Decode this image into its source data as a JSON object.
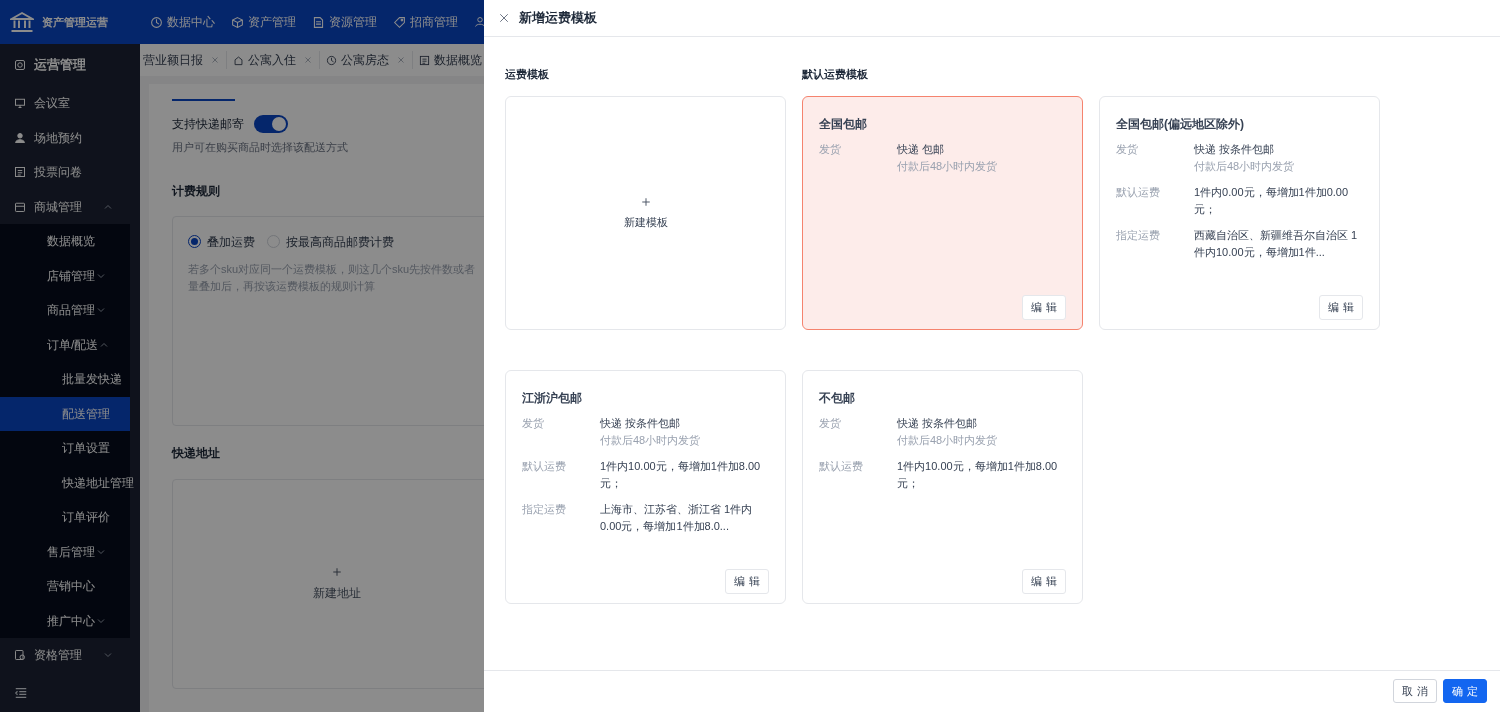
{
  "app": {
    "title": "资产管理运营",
    "top_nav": [
      {
        "label": "数据中心"
      },
      {
        "label": "资产管理"
      },
      {
        "label": "资源管理"
      },
      {
        "label": "招商管理"
      }
    ],
    "sidebar": {
      "header": "运营管理",
      "items": [
        {
          "label": "会议室",
          "kind": "link",
          "selected": false
        },
        {
          "label": "场地预约",
          "kind": "link",
          "selected": false
        },
        {
          "label": "投票问卷",
          "kind": "link",
          "selected": false
        },
        {
          "label": "商城管理",
          "kind": "group",
          "expanded": true,
          "children": [
            {
              "label": "数据概览",
              "kind": "link",
              "selected": false
            },
            {
              "label": "店铺管理",
              "kind": "group",
              "expanded": false
            },
            {
              "label": "商品管理",
              "kind": "group",
              "expanded": false
            },
            {
              "label": "订单/配送",
              "kind": "group",
              "expanded": true,
              "children": [
                {
                  "label": "批量发快递",
                  "kind": "link",
                  "selected": false
                },
                {
                  "label": "配送管理",
                  "kind": "link",
                  "selected": true
                },
                {
                  "label": "订单设置",
                  "kind": "link",
                  "selected": false
                },
                {
                  "label": "快递地址管理",
                  "kind": "link",
                  "selected": false
                },
                {
                  "label": "订单评价",
                  "kind": "link",
                  "selected": false
                }
              ]
            },
            {
              "label": "售后管理",
              "kind": "group",
              "expanded": false
            },
            {
              "label": "营销中心",
              "kind": "link",
              "selected": false
            },
            {
              "label": "推广中心",
              "kind": "group",
              "expanded": false
            }
          ]
        },
        {
          "label": "资格管理",
          "kind": "group",
          "expanded": false
        }
      ]
    },
    "tabs": [
      {
        "label": "营业额日报"
      },
      {
        "label": "公寓入住"
      },
      {
        "label": "公寓房态"
      },
      {
        "label": "数据概览"
      }
    ],
    "form": {
      "toggle_label": "支持快递邮寄",
      "toggle_on": true,
      "toggle_hint": "用户可在购买商品时选择该配送方式",
      "billing_title": "计费规则",
      "billing_options": [
        {
          "label": "叠加运费",
          "selected": true
        },
        {
          "label": "按最高商品邮费计费",
          "selected": false
        }
      ],
      "billing_note": [
        "若多个sku对应同一个运费模板，则这几个sku先按件数或者",
        "量叠加后，再按该运费模板的规则计算"
      ],
      "address_title": "快递地址",
      "new_address": "新建地址"
    }
  },
  "drawer": {
    "title": "新增运费模板",
    "section_templates": "运费模板",
    "section_default": "默认运费模板",
    "new_template": "新建模板",
    "templates": [
      {
        "name": "全国包邮",
        "selected": true,
        "rows": [
          {
            "label": "发货",
            "value": "快递 包邮",
            "note": "付款后48小时内发货"
          }
        ],
        "edit": "编 辑"
      },
      {
        "name": "全国包邮(偏远地区除外)",
        "selected": false,
        "rows": [
          {
            "label": "发货",
            "value": "快递 按条件包邮",
            "note": "付款后48小时内发货"
          },
          {
            "label": "默认运费",
            "value": "1件内0.00元，每增加1件加0.00元；"
          },
          {
            "label": "指定运费",
            "value": "西藏自治区、新疆维吾尔自治区 1件内10.00元，每增加1件..."
          }
        ],
        "edit": "编 辑"
      },
      {
        "name": "江浙沪包邮",
        "selected": false,
        "rows": [
          {
            "label": "发货",
            "value": "快递 按条件包邮",
            "note": "付款后48小时内发货"
          },
          {
            "label": "默认运费",
            "value": "1件内10.00元，每增加1件加8.00元；"
          },
          {
            "label": "指定运费",
            "value": "上海市、江苏省、浙江省 1件内0.00元，每增加1件加8.0..."
          }
        ],
        "edit": "编 辑"
      },
      {
        "name": "不包邮",
        "selected": false,
        "rows": [
          {
            "label": "发货",
            "value": "快递 按条件包邮",
            "note": "付款后48小时内发货"
          },
          {
            "label": "默认运费",
            "value": "1件内10.00元，每增加1件加8.00元；"
          }
        ],
        "edit": "编 辑"
      }
    ],
    "buttons": [
      {
        "label": "取 消",
        "kind": "secondary"
      },
      {
        "label": "确 定",
        "kind": "primary"
      }
    ]
  }
}
